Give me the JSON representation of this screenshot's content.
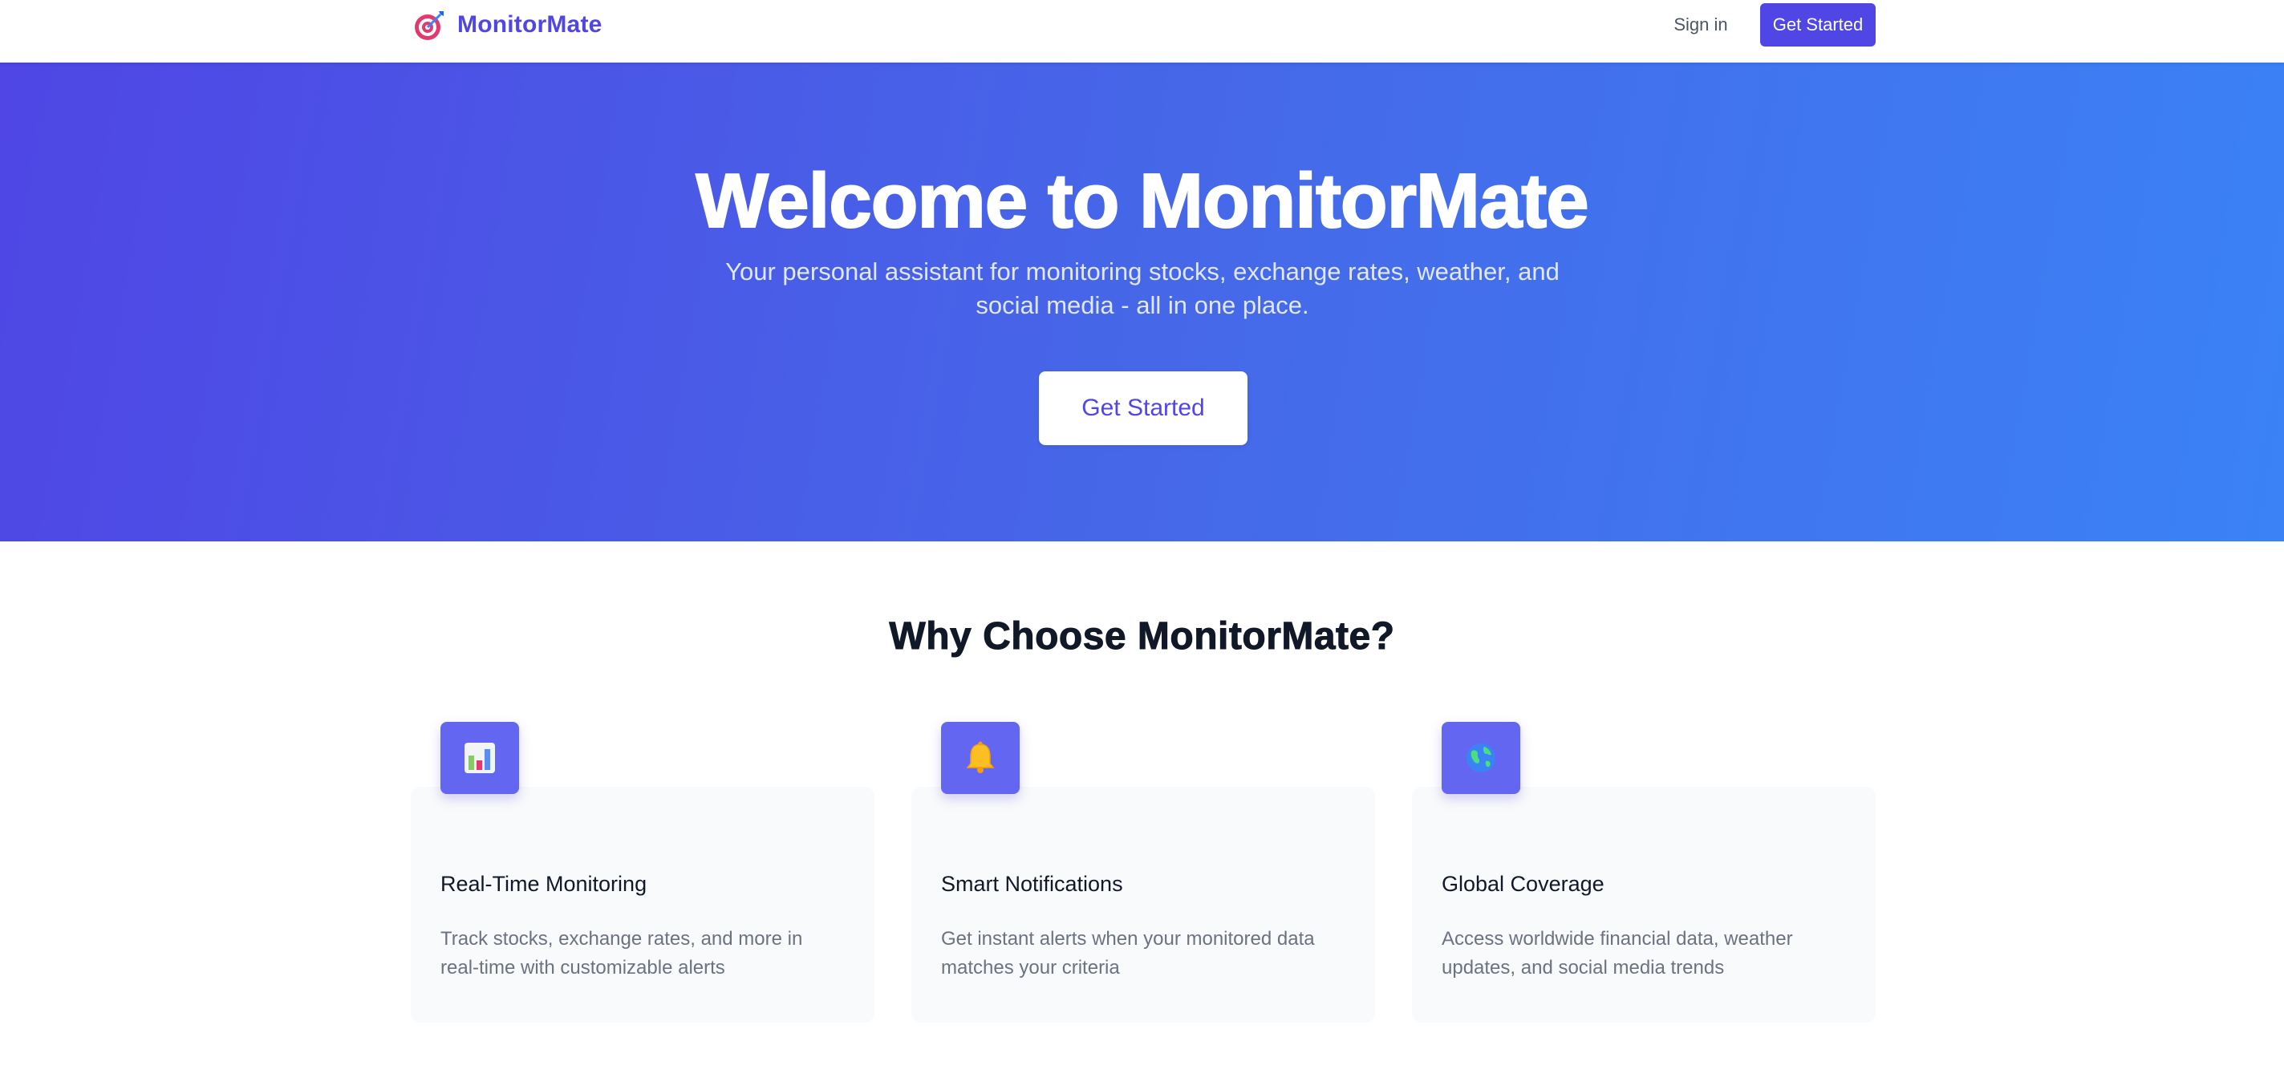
{
  "nav": {
    "brand": "MonitorMate",
    "brand_icon": "target-dart-icon",
    "signin_label": "Sign in",
    "cta_label": "Get Started"
  },
  "hero": {
    "title": "Welcome to MonitorMate",
    "subtitle": "Your personal assistant for monitoring stocks, exchange rates, weather, and social media - all in one place.",
    "cta_label": "Get Started"
  },
  "features": {
    "title": "Why Choose MonitorMate?",
    "items": [
      {
        "icon": "bar-chart-icon",
        "title": "Real-Time Monitoring",
        "description": "Track stocks, exchange rates, and more in real-time with customizable alerts"
      },
      {
        "icon": "bell-icon",
        "title": "Smart Notifications",
        "description": "Get instant alerts when your monitored data matches your criteria"
      },
      {
        "icon": "globe-icon",
        "title": "Global Coverage",
        "description": "Access worldwide financial data, weather updates, and social media trends"
      }
    ]
  },
  "colors": {
    "brand": "#4f46e5",
    "gradient_start": "#4f46e5",
    "gradient_end": "#3b82f6",
    "icon_bg": "#6366f1",
    "card_bg": "#f9fafb",
    "muted_text": "#6b7280"
  }
}
